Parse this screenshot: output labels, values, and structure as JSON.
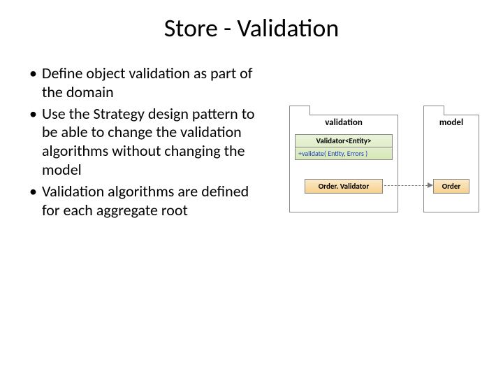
{
  "title": "Store - Validation",
  "bullets": [
    "Define object validation as part of the domain",
    "Use the Strategy design pattern to be able to change the validation algorithms without changing the model",
    "Validation algorithms are defined for each aggregate root"
  ],
  "diagram": {
    "packages": {
      "validation": {
        "label": "validation"
      },
      "model": {
        "label": "model"
      }
    },
    "classes": {
      "validator": {
        "name": "Validator<Entity>",
        "op": "+validate( Entity, Errors )"
      },
      "orderValidator": {
        "name": "Order. Validator"
      },
      "order": {
        "name": "Order"
      }
    }
  }
}
